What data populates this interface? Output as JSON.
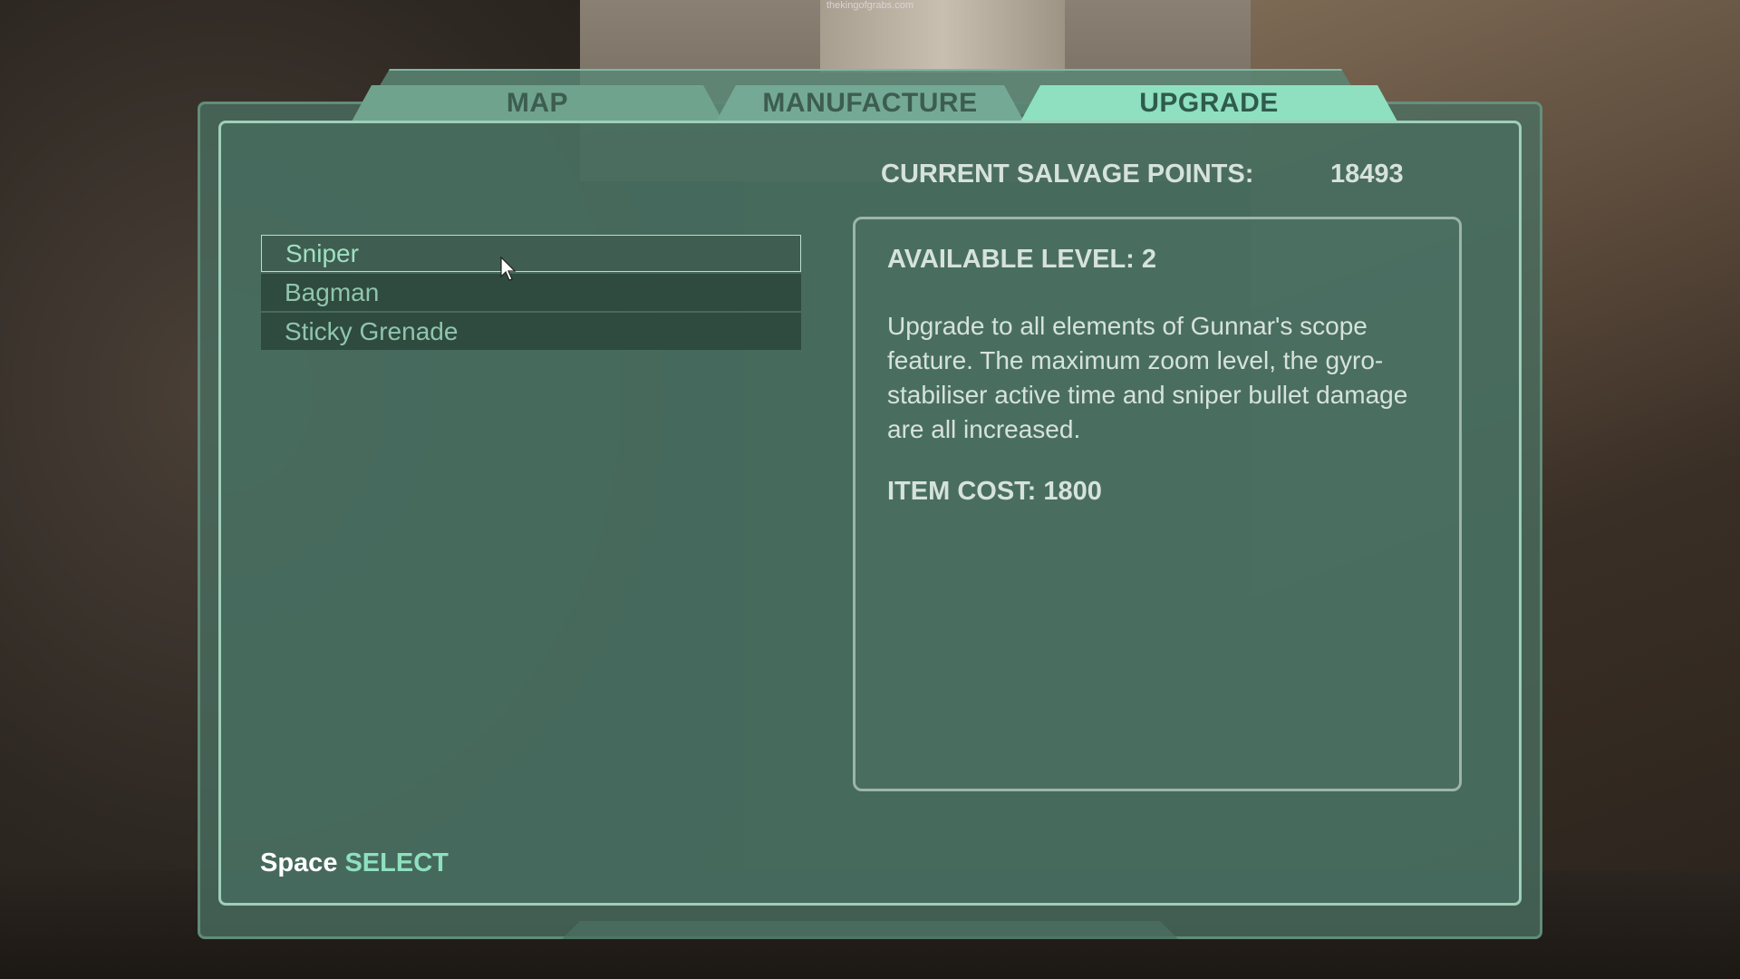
{
  "watermark": "thekingofgrabs.com",
  "tabs": [
    {
      "label": "MAP",
      "active": false
    },
    {
      "label": "MANUFACTURE",
      "active": false
    },
    {
      "label": "UPGRADE",
      "active": true
    }
  ],
  "salvage": {
    "label": "CURRENT SALVAGE POINTS:",
    "value": "18493"
  },
  "upgrades": [
    {
      "label": "Sniper",
      "selected": true
    },
    {
      "label": "Bagman",
      "selected": false
    },
    {
      "label": "Sticky Grenade",
      "selected": false
    }
  ],
  "detail": {
    "available_level": "AVAILABLE LEVEL: 2",
    "description": "Upgrade to all elements of Gunnar's scope feature. The maximum zoom level, the gyro-stabiliser active time and sniper bullet damage are all increased.",
    "item_cost": "ITEM COST: 1800"
  },
  "hint": {
    "key": "Space",
    "action": "SELECT"
  },
  "colors": {
    "active_tab": "#8ee0c0",
    "accent_text": "#8fe0bf",
    "panel": "#466e60"
  }
}
